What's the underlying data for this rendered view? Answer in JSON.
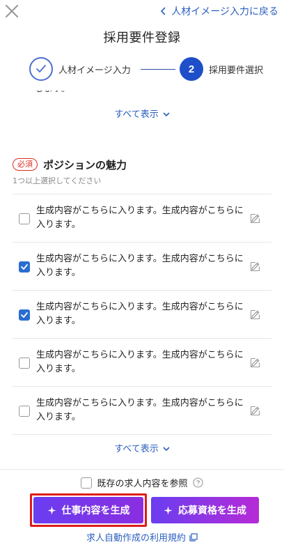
{
  "header": {
    "close_icon": "close-icon",
    "back_link": "人材イメージ入力に戻る",
    "title": "採用要件登録"
  },
  "stepper": {
    "step1_label": "人材イメージ入力",
    "step2_number": "2",
    "step2_label": "採用要件選択"
  },
  "prev_section": {
    "cut_text": "します。",
    "show_all": "すべて表示"
  },
  "section": {
    "required_badge": "必須",
    "title": "ポジションの魅力",
    "subtitle": "1つ以上選択してください",
    "options": [
      {
        "text": "生成内容がこちらに入ります。生成内容がこちらに入ります。",
        "checked": false
      },
      {
        "text": "生成内容がこちらに入ります。生成内容がこちらに入ります。",
        "checked": true
      },
      {
        "text": "生成内容がこちらに入ります。生成内容がこちらに入ります。",
        "checked": true
      },
      {
        "text": "生成内容がこちらに入ります。生成内容がこちらに入ります。",
        "checked": false
      },
      {
        "text": "生成内容がこちらに入ります。生成内容がこちらに入ります。",
        "checked": false
      }
    ],
    "show_all": "すべて表示"
  },
  "footer": {
    "reference_label": "既存の求人内容を参照",
    "reference_checked": false,
    "generate_job_label": "仕事内容を生成",
    "generate_qualification_label": "応募資格を生成",
    "terms_link": "求人自動作成の利用規約"
  },
  "colors": {
    "accent_blue": "#1e4fc9",
    "link_blue": "#2b5fbf",
    "checkbox_blue": "#2a6dd0",
    "required_red": "#d93025",
    "button_purple": "#6a3ef0",
    "button_magenta": "#b52bd6",
    "highlight_red": "#e01b1b"
  }
}
